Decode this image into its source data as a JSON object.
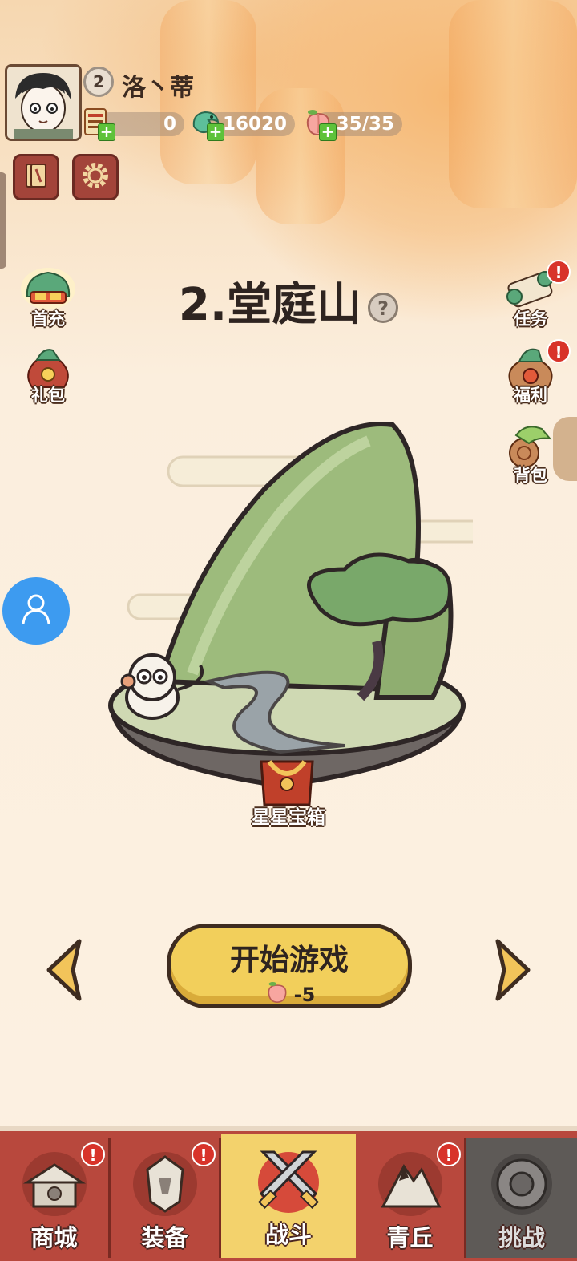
{
  "player": {
    "level": "2",
    "name": "洛丶蒂"
  },
  "resources": [
    {
      "icon": "ticket-icon",
      "value": "0"
    },
    {
      "icon": "jade-dragon-icon",
      "value": "16020"
    },
    {
      "icon": "peach-stamina-icon",
      "value": "35/35"
    }
  ],
  "left_menu": [
    {
      "label": "首充",
      "icon": "first-recharge-icon"
    },
    {
      "label": "礼包",
      "icon": "gift-bag-icon"
    }
  ],
  "right_menu": [
    {
      "label": "任务",
      "icon": "task-scroll-icon",
      "badge": "!"
    },
    {
      "label": "福利",
      "icon": "welfare-bag-icon",
      "badge": "!"
    },
    {
      "label": "背包",
      "icon": "backpack-icon"
    }
  ],
  "stage": {
    "title": "2.堂庭山",
    "help": "?",
    "chest_label": "星星宝箱"
  },
  "start_button": {
    "label": "开始游戏",
    "cost": "-5"
  },
  "nav": [
    {
      "label": "商城",
      "icon": "shop-icon",
      "badge": "!",
      "active": false
    },
    {
      "label": "装备",
      "icon": "armor-icon",
      "badge": "!",
      "active": false
    },
    {
      "label": "战斗",
      "icon": "crossed-swords-icon",
      "badge": "",
      "active": true
    },
    {
      "label": "青丘",
      "icon": "mountain-icon",
      "badge": "!",
      "active": false
    },
    {
      "label": "挑战",
      "icon": "challenge-icon",
      "badge": "",
      "active": false,
      "locked": true
    }
  ],
  "colors": {
    "nav_bg": "#b8483d",
    "nav_active": "#f3d26c",
    "nav_locked": "#5e5a57",
    "button_yellow": "#f2cf5b",
    "badge_red": "#d8332a"
  }
}
